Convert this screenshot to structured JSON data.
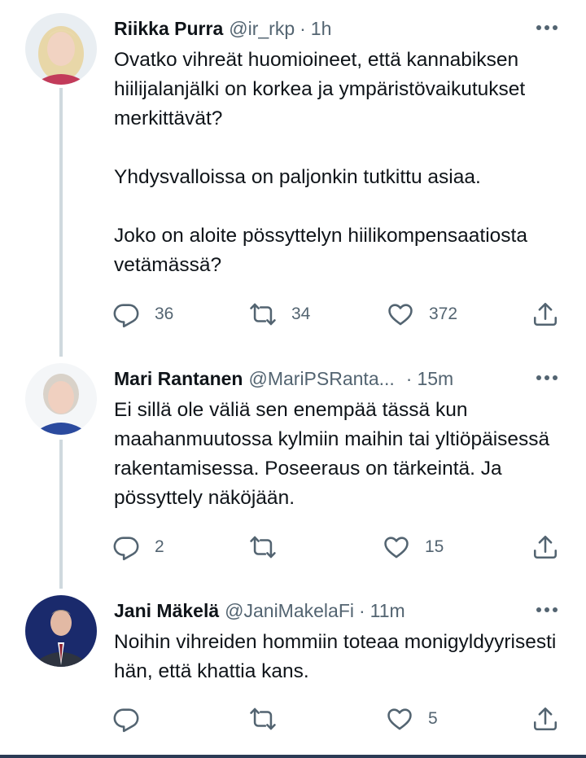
{
  "tweets": [
    {
      "name": "Riikka Purra",
      "handle": "@ir_rkp",
      "separator": "·",
      "time": "1h",
      "paragraphs": [
        "Ovatko vihreät huomioineet, että kannabiksen hiilijalanjälki on korkea ja ympäristövaikutukset merkittävät?",
        "Yhdysvalloissa on paljonkin tutkittu asiaa.",
        "Joko on aloite pössyttelyn hiilikompensaatiosta vetämässä?"
      ],
      "replies": "36",
      "retweets": "34",
      "likes": "372"
    },
    {
      "name": "Mari Rantanen",
      "handle": "@MariPSRanta...",
      "separator": "·",
      "time": "15m",
      "paragraphs": [
        "Ei sillä ole väliä sen enempää tässä kun maahanmuutossa kylmiin maihin tai yltiöpäisessä rakentamisessa. Poseeraus on tärkeintä. Ja pössyttely näköjään."
      ],
      "replies": "2",
      "retweets": "",
      "likes": "15"
    },
    {
      "name": "Jani Mäkelä",
      "handle": "@JaniMakelaFi",
      "separator": "·",
      "time": "11m",
      "paragraphs": [
        "Noihin vihreiden hommiin toteaa monigyldyyrisesti hän, että khattia kans."
      ],
      "replies": "",
      "retweets": "",
      "likes": "5"
    }
  ],
  "icons": {
    "reply": "reply-icon",
    "retweet": "retweet-icon",
    "like": "heart-icon",
    "share": "share-icon",
    "more": "more-icon"
  },
  "colors": {
    "text": "#0f1419",
    "secondary": "#536471",
    "thread_line": "#cfd9de"
  }
}
